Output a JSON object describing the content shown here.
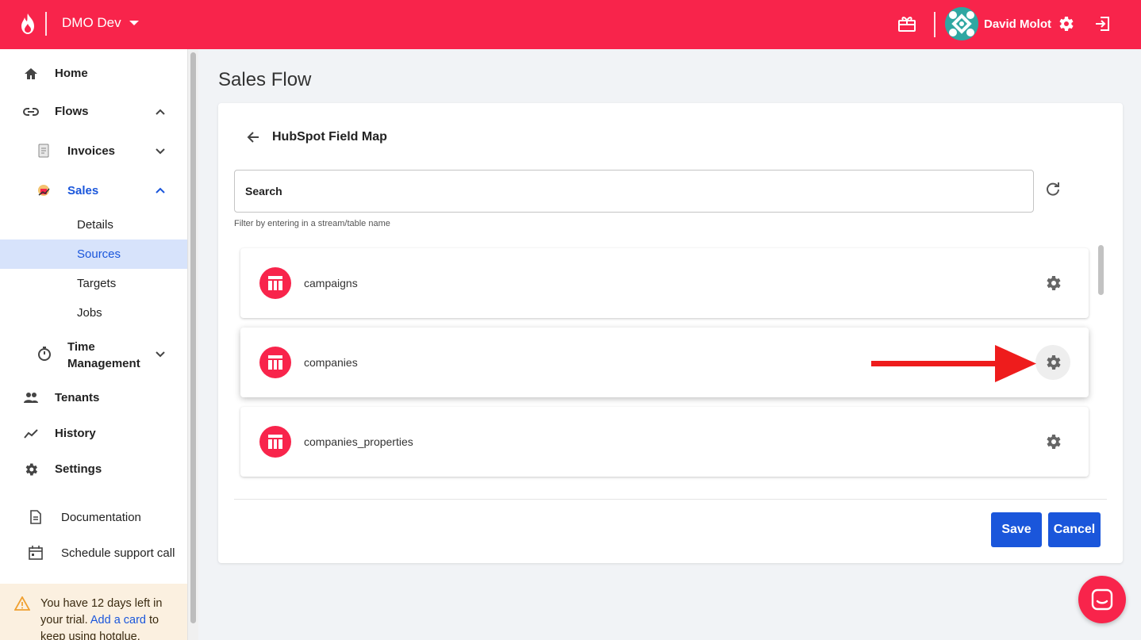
{
  "header": {
    "org_name": "DMO Dev",
    "user_name": "David Molot",
    "brand_color": "#f8244b"
  },
  "sidebar": {
    "home": "Home",
    "flows": "Flows",
    "invoices": "Invoices",
    "sales": "Sales",
    "sales_sub": [
      "Details",
      "Sources",
      "Targets",
      "Jobs"
    ],
    "time_management": "Time Management",
    "tenants": "Tenants",
    "history": "History",
    "settings": "Settings",
    "documentation": "Documentation",
    "schedule_support": "Schedule support call",
    "active_sub": "Sources",
    "active_color": "#1a56db"
  },
  "trial": {
    "prefix": "You have 12 days left in your trial. ",
    "link": "Add a card",
    "suffix": " to keep using hotglue."
  },
  "main": {
    "page_title": "Sales Flow",
    "card_title": "HubSpot Field Map",
    "search_placeholder": "Search",
    "helper_text": "Filter by entering in a stream/table name",
    "streams": [
      "campaigns",
      "companies",
      "companies_properties"
    ],
    "save_label": "Save",
    "cancel_label": "Cancel",
    "button_color": "#1a56db"
  }
}
